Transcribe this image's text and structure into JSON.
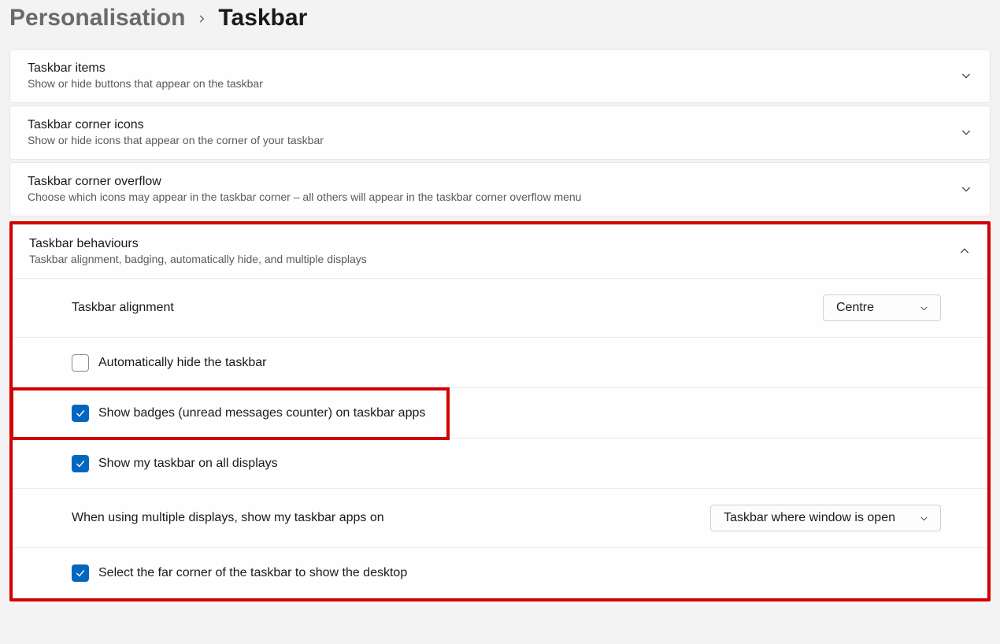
{
  "breadcrumb": {
    "parent": "Personalisation",
    "current": "Taskbar"
  },
  "sections": {
    "taskbar_items": {
      "title": "Taskbar items",
      "desc": "Show or hide buttons that appear on the taskbar"
    },
    "corner_icons": {
      "title": "Taskbar corner icons",
      "desc": "Show or hide icons that appear on the corner of your taskbar"
    },
    "corner_overflow": {
      "title": "Taskbar corner overflow",
      "desc": "Choose which icons may appear in the taskbar corner – all others will appear in the taskbar corner overflow menu"
    },
    "behaviours": {
      "title": "Taskbar behaviours",
      "desc": "Taskbar alignment, badging, automatically hide, and multiple displays",
      "alignment": {
        "label": "Taskbar alignment",
        "value": "Centre"
      },
      "auto_hide": {
        "label": "Automatically hide the taskbar",
        "checked": false
      },
      "show_badges": {
        "label": "Show badges (unread messages counter) on taskbar apps",
        "checked": true
      },
      "all_displays": {
        "label": "Show my taskbar on all displays",
        "checked": true
      },
      "multi_display": {
        "label": "When using multiple displays, show my taskbar apps on",
        "value": "Taskbar where window is open"
      },
      "far_corner": {
        "label": "Select the far corner of the taskbar to show the desktop",
        "checked": true
      }
    }
  }
}
